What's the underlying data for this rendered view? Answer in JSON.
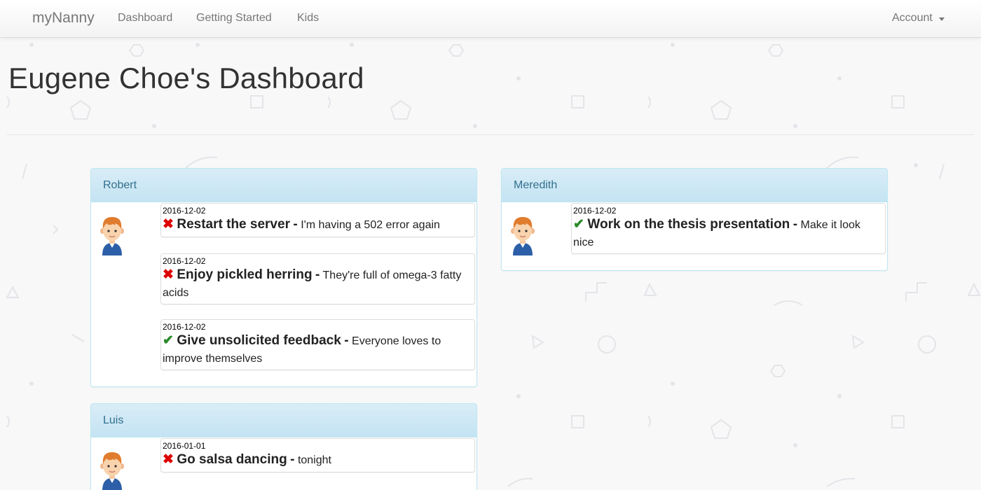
{
  "navbar": {
    "brand": "myNanny",
    "links": [
      "Dashboard",
      "Getting Started",
      "Kids"
    ],
    "account_label": "Account"
  },
  "page_title": "Eugene Choe's Dashboard",
  "kids": [
    {
      "name": "Robert",
      "tasks": [
        {
          "date": "2016-12-02",
          "done": false,
          "title": "Restart the server",
          "separator": "-",
          "note": "I'm having a 502 error again"
        },
        {
          "date": "2016-12-02",
          "done": false,
          "title": "Enjoy pickled herring",
          "separator": "-",
          "note": "They're full of omega-3 fatty acids"
        },
        {
          "date": "2016-12-02",
          "done": true,
          "title": "Give unsolicited feedback",
          "separator": "-",
          "note": "Everyone loves to improve themselves"
        }
      ]
    },
    {
      "name": "Meredith",
      "tasks": [
        {
          "date": "2016-12-02",
          "done": true,
          "title": "Work on the thesis presentation",
          "separator": "-",
          "note": "Make it look nice"
        }
      ]
    },
    {
      "name": "Luis",
      "tasks": [
        {
          "date": "2016-01-01",
          "done": false,
          "title": "Go salsa dancing",
          "separator": "-",
          "note": "tonight"
        }
      ]
    }
  ],
  "icons": {
    "incomplete": "x-icon",
    "complete": "check-icon",
    "avatar": "boy-avatar-icon"
  },
  "colors": {
    "panel_heading": "#d9edf7",
    "panel_text": "#31708f",
    "incomplete": "#dd0000",
    "complete": "#2a8a2a"
  }
}
